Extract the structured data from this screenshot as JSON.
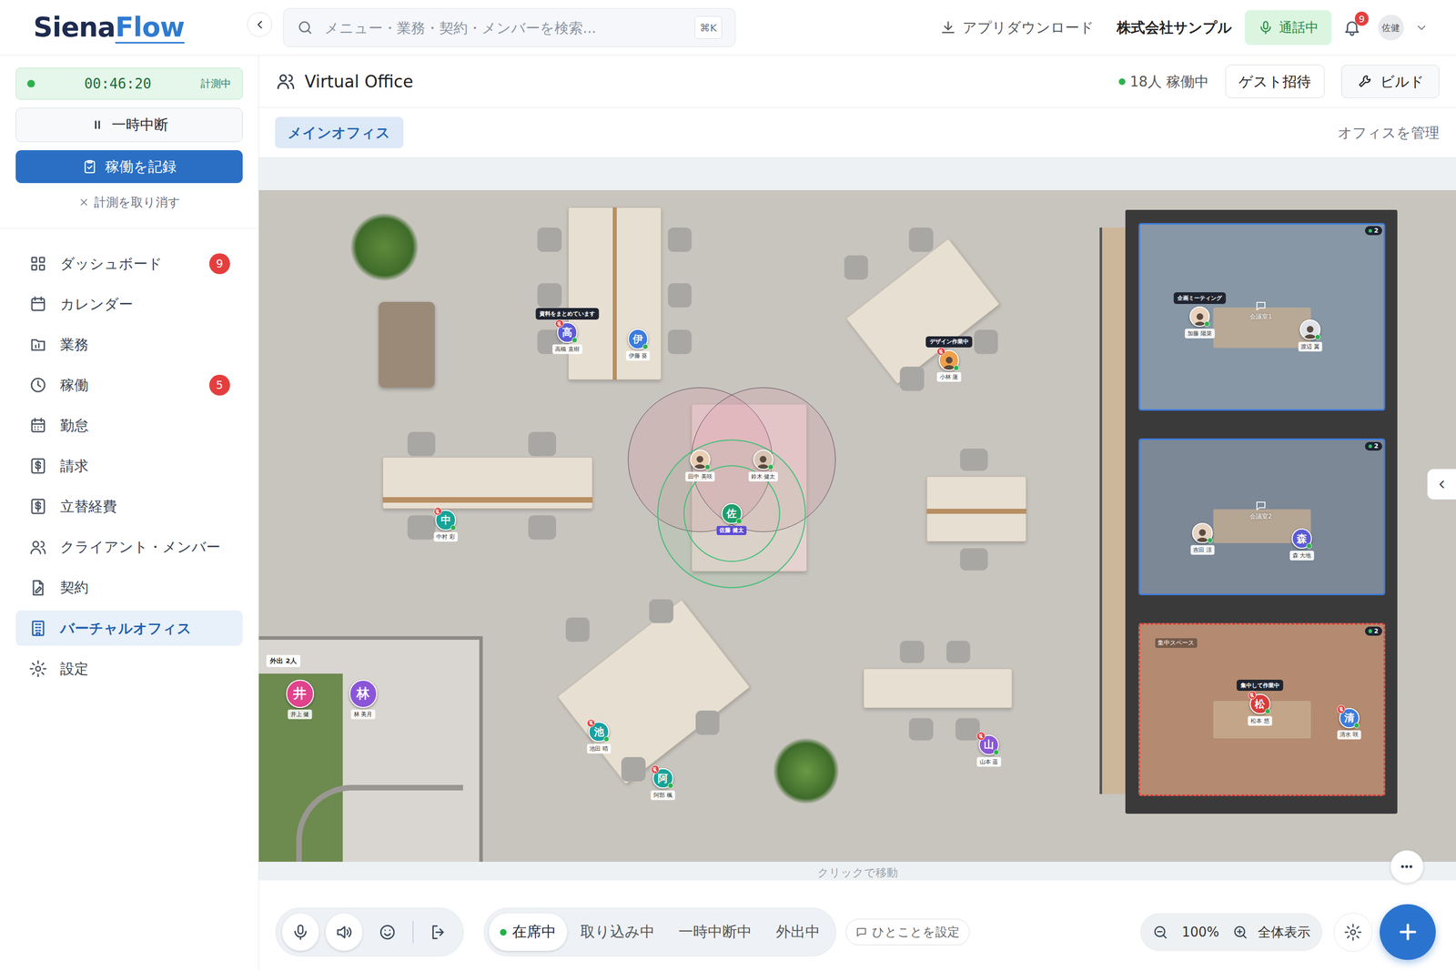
{
  "header": {
    "logo": {
      "part1": "Siena",
      "part2": "Flow"
    },
    "search": {
      "placeholder": "メニュー・業務・契約・メンバーを検索...",
      "shortcut": "⌘K"
    },
    "download": "アプリダウンロード",
    "company": "株式会社サンプル",
    "call": "通話中",
    "notifications": "9",
    "user": "佐健"
  },
  "timer": {
    "time": "00:46:20",
    "state": "計測中",
    "running": true
  },
  "pause_button": "一時中断",
  "record_button": "稼働を記録",
  "cancel": "計測を取り消す",
  "nav": [
    {
      "label": "ダッシュボード",
      "badge": "9",
      "selected": false
    },
    {
      "label": "カレンダー",
      "badge": null,
      "selected": false
    },
    {
      "label": "業務",
      "badge": null,
      "selected": false
    },
    {
      "label": "稼働",
      "badge": "5",
      "selected": false
    },
    {
      "label": "勤怠",
      "badge": null,
      "selected": false
    },
    {
      "label": "請求",
      "badge": null,
      "selected": false
    },
    {
      "label": "立替経費",
      "badge": null,
      "selected": false
    },
    {
      "label": "クライアント・メンバー",
      "badge": null,
      "selected": false
    },
    {
      "label": "契約",
      "badge": null,
      "selected": false
    },
    {
      "label": "バーチャルオフィス",
      "badge": null,
      "selected": true
    },
    {
      "label": "設定",
      "badge": null,
      "selected": false
    }
  ],
  "office": {
    "title": "Virtual Office",
    "online": "18人 稼働中",
    "invite": "ゲスト招待",
    "build": "ビルド"
  },
  "tabs": [
    {
      "label": "メインオフィス",
      "selected": true
    }
  ],
  "manage": "オフィスを管理",
  "map": {
    "away_zone": "外出 2人",
    "rooms": [
      {
        "label": "会議室1",
        "count": "2",
        "kind": "meeting"
      },
      {
        "label": "会議室2",
        "count": "2",
        "kind": "meeting"
      },
      {
        "label": "集中スペース",
        "count": "2",
        "kind": "focus"
      }
    ],
    "members": [
      {
        "initial": "高",
        "name": "高橋 直樹",
        "status": "資料をまとめています",
        "kind": "letter",
        "color": "#5b5bd6",
        "muted": true,
        "online": true,
        "self": false
      },
      {
        "initial": "伊",
        "name": "伊藤 葵",
        "status": null,
        "kind": "letter",
        "color": "#3d7be0",
        "muted": false,
        "online": true,
        "self": false
      },
      {
        "initial": null,
        "name": "小林 蓮",
        "status": "デザイン作業中",
        "kind": "photo",
        "color": "#f0a04b",
        "muted": true,
        "online": true,
        "self": false
      },
      {
        "initial": null,
        "name": "田中 美咲",
        "status": null,
        "kind": "photo",
        "color": "#e8cfb4",
        "muted": false,
        "online": true,
        "self": false
      },
      {
        "initial": null,
        "name": "鈴木 健太",
        "status": null,
        "kind": "photo",
        "color": "#d8c6b4",
        "muted": false,
        "online": true,
        "self": false
      },
      {
        "initial": "佐",
        "name": "佐藤 健太",
        "status": null,
        "kind": "letter",
        "color": "#1e9e6b",
        "muted": false,
        "online": true,
        "self": true
      },
      {
        "initial": "中",
        "name": "中村 彩",
        "status": null,
        "kind": "letter",
        "color": "#17a398",
        "muted": true,
        "online": true,
        "self": false
      },
      {
        "initial": "池",
        "name": "池田 晴",
        "status": null,
        "kind": "letter",
        "color": "#1aa0a0",
        "muted": true,
        "online": true,
        "self": false
      },
      {
        "initial": "阿",
        "name": "阿部 楓",
        "status": null,
        "kind": "letter",
        "color": "#17a398",
        "muted": true,
        "online": true,
        "self": false
      },
      {
        "initial": "山",
        "name": "山本 遥",
        "status": null,
        "kind": "letter",
        "color": "#8a55d8",
        "muted": true,
        "online": true,
        "self": false
      },
      {
        "initial": null,
        "name": "加藤 陽菜",
        "status": "企画ミーティング",
        "kind": "photo",
        "color": "#ead2bd",
        "muted": false,
        "online": true,
        "self": false
      },
      {
        "initial": null,
        "name": "渡辺 翼",
        "status": null,
        "kind": "photo",
        "color": "#dfe3e8",
        "muted": false,
        "online": true,
        "self": false
      },
      {
        "initial": null,
        "name": "吉田 涼",
        "status": null,
        "kind": "photo",
        "color": "#e6d3c2",
        "muted": false,
        "online": true,
        "self": false
      },
      {
        "initial": "森",
        "name": "森 大地",
        "status": null,
        "kind": "letter",
        "color": "#5b5bd6",
        "muted": false,
        "online": true,
        "self": false
      },
      {
        "initial": "松",
        "name": "松本 悠",
        "status": "集中して作業中",
        "kind": "letter",
        "color": "#d93a3a",
        "muted": true,
        "online": true,
        "self": false
      },
      {
        "initial": "清",
        "name": "清水 咲",
        "status": null,
        "kind": "letter",
        "color": "#3d7be0",
        "muted": true,
        "online": true,
        "self": false
      },
      {
        "initial": "井",
        "name": "井上 健",
        "status": null,
        "kind": "away",
        "color": "#e0438c",
        "muted": false,
        "self": false
      },
      {
        "initial": "林",
        "name": "林 美月",
        "status": null,
        "kind": "away",
        "color": "#8a55d8",
        "muted": false,
        "self": false
      }
    ]
  },
  "hint": "クリックで移動",
  "toolbar": {
    "mic_on": true,
    "speaker_on": true,
    "statuses": [
      {
        "label": "在席中",
        "selected": true
      },
      {
        "label": "取り込み中",
        "selected": false
      },
      {
        "label": "一時中断中",
        "selected": false
      },
      {
        "label": "外出中",
        "selected": false
      }
    ],
    "note": "ひとことを設定",
    "zoom": "100%",
    "fit": "全体表示"
  }
}
